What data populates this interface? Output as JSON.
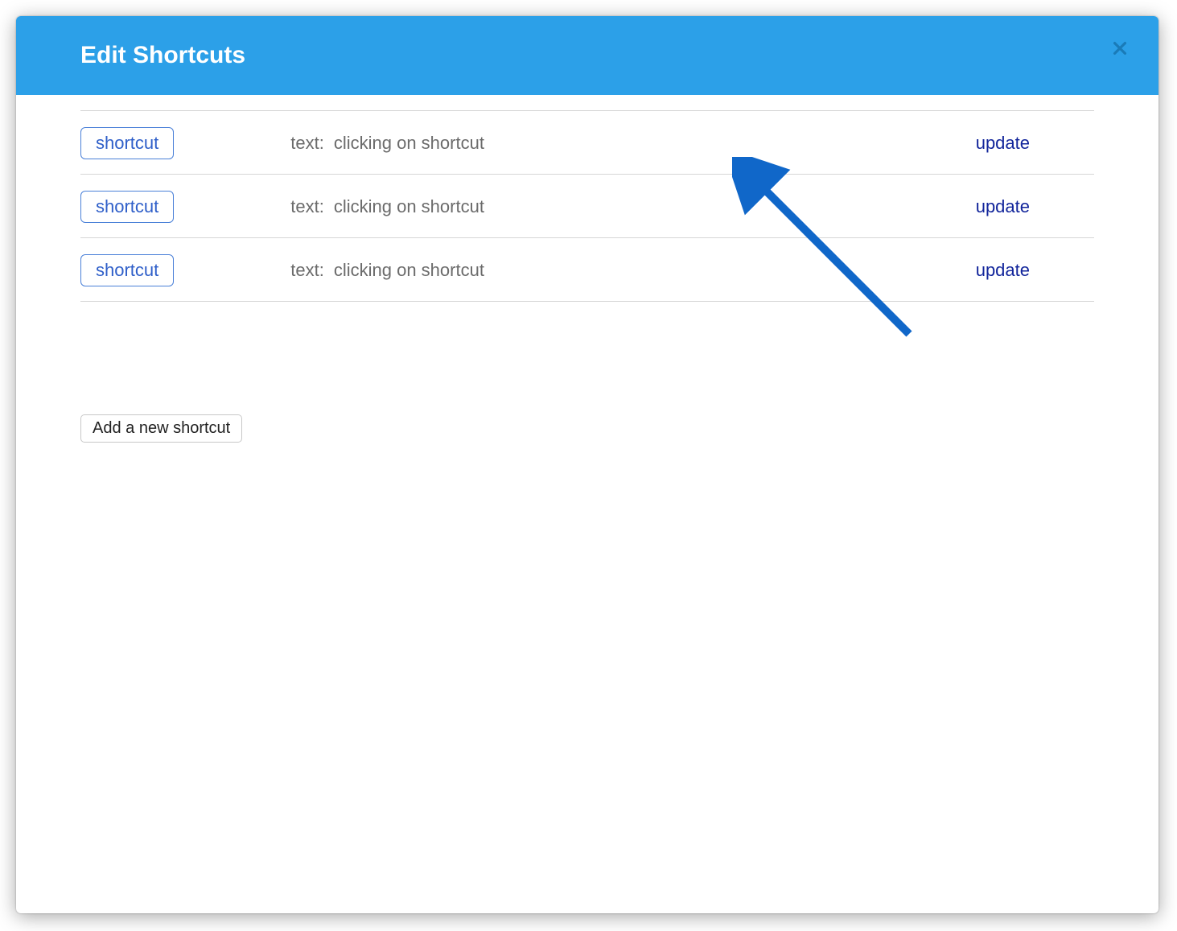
{
  "modal": {
    "title": "Edit Shortcuts",
    "close_label": "Close"
  },
  "rows": [
    {
      "shortcut_label": "shortcut",
      "text_label": "text:",
      "text_value": "clicking on shortcut",
      "update_label": "update"
    },
    {
      "shortcut_label": "shortcut",
      "text_label": "text:",
      "text_value": "clicking on shortcut",
      "update_label": "update"
    },
    {
      "shortcut_label": "shortcut",
      "text_label": "text:",
      "text_value": "clicking on shortcut",
      "update_label": "update"
    }
  ],
  "actions": {
    "add_label": "Add a new shortcut"
  },
  "annotation": {
    "type": "arrow",
    "target": "update-link-row-0",
    "color": "#1067c9"
  }
}
